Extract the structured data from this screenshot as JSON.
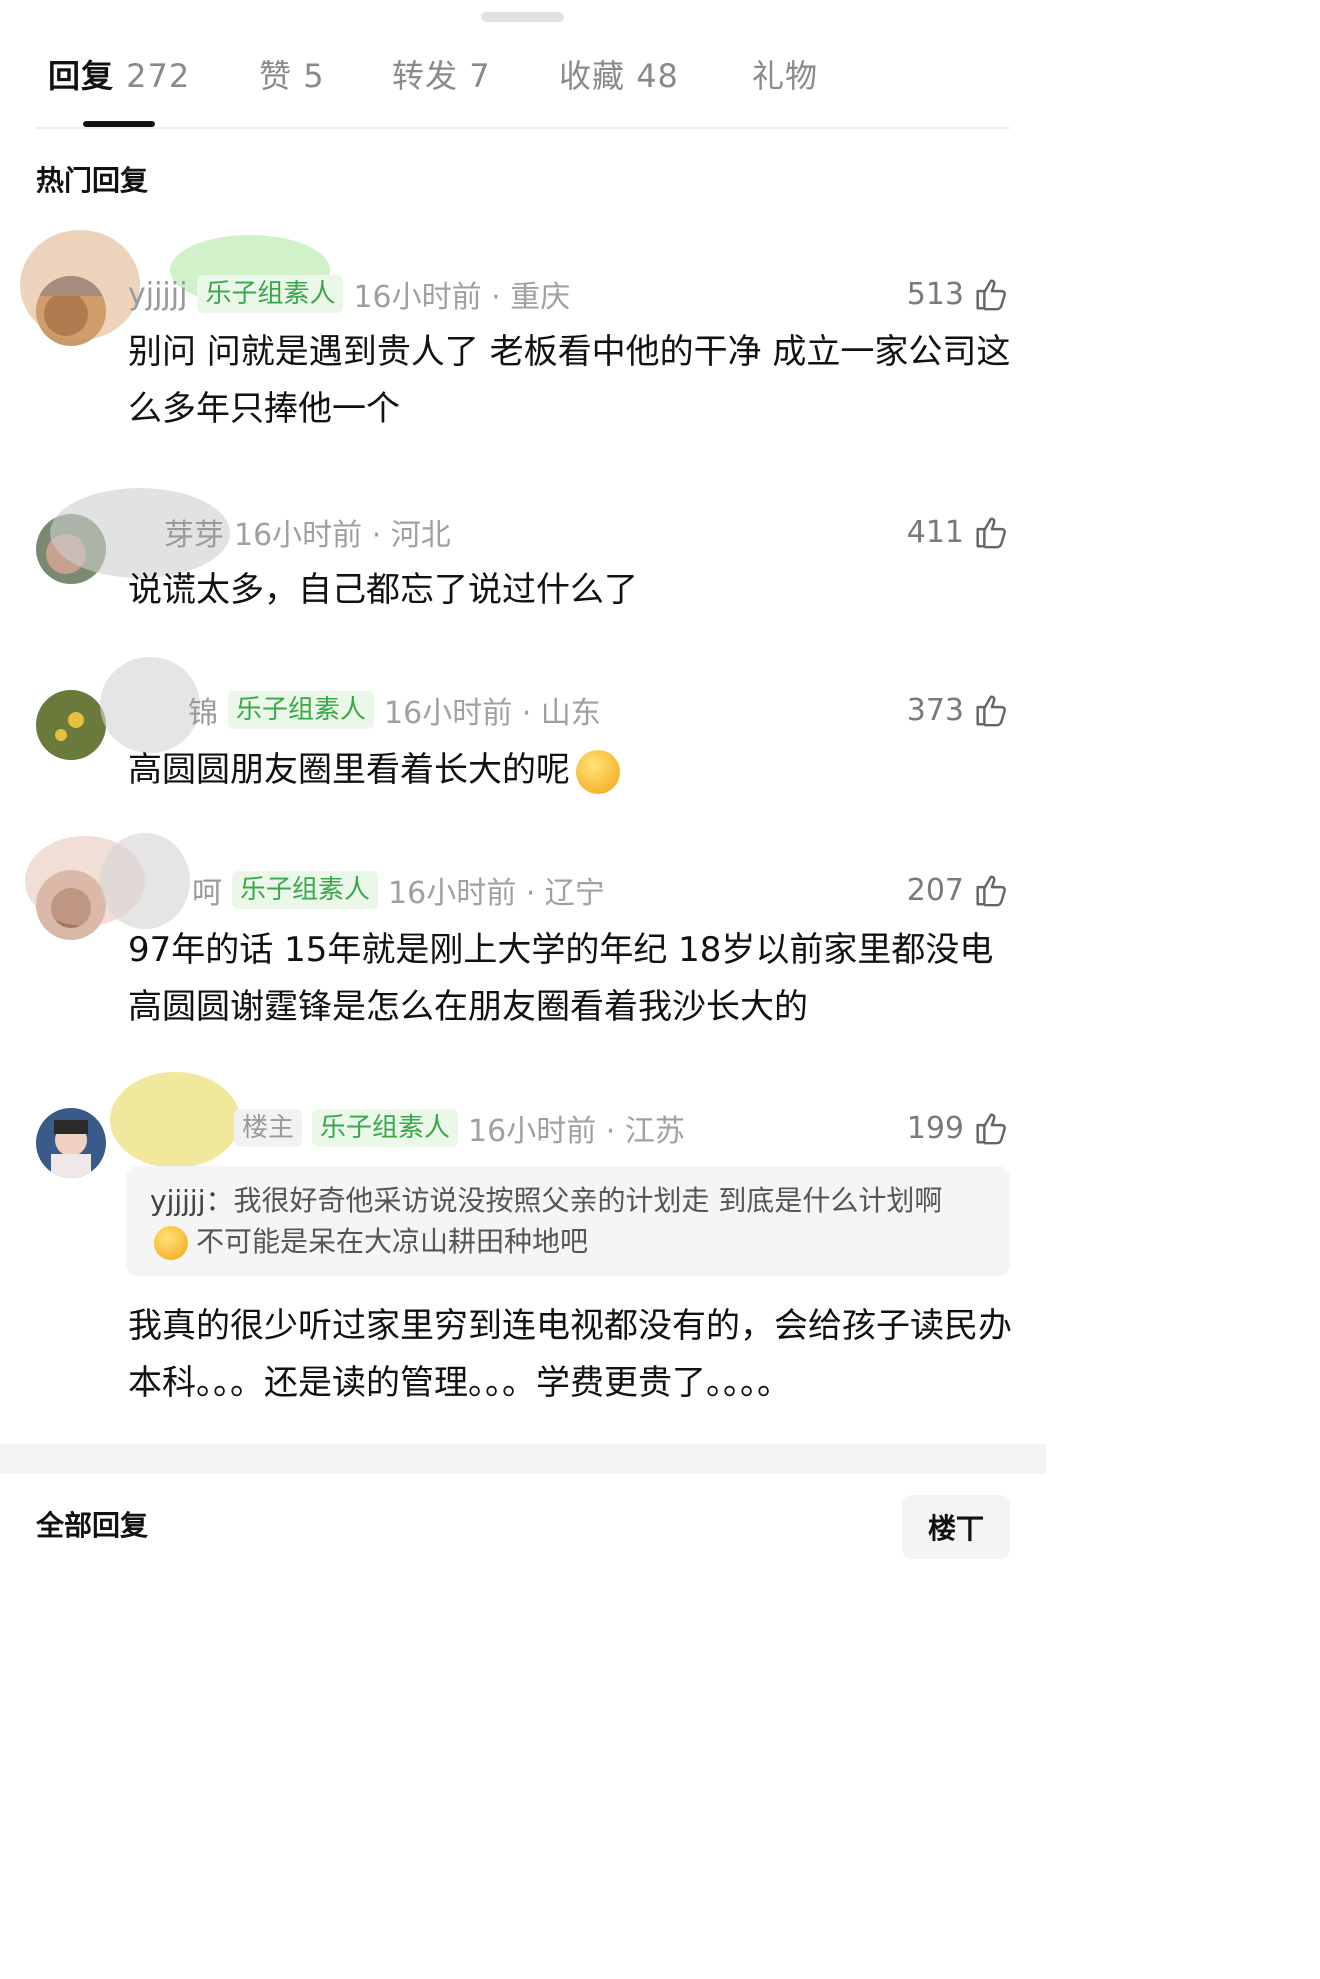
{
  "tabs": [
    {
      "label": "回复",
      "count": "272"
    },
    {
      "label": "赞",
      "count": "5"
    },
    {
      "label": "转发",
      "count": "7"
    },
    {
      "label": "收藏",
      "count": "48"
    },
    {
      "label": "礼物",
      "count": ""
    }
  ],
  "hot_title": "热门回复",
  "all_title": "全部回复",
  "sort_label": "楼丅",
  "colors": {
    "badge_green": "#3aa84a",
    "badge_bg": "#eaf7e9"
  },
  "comments": [
    {
      "username": "yjjjjj",
      "badge": "乐子组素人",
      "time_loc": "16小时前 · 重庆",
      "likes": "513",
      "text": "别问 问就是遇到贵人了 老板看中他的干净  成立一家公司这么多年只捧他一个"
    },
    {
      "username": "芽芽",
      "badge": "",
      "time_loc": "16小时前 · 河北",
      "likes": "411",
      "text": "说谎太多，自己都忘了说过什么了"
    },
    {
      "username": "锦",
      "badge": "乐子组素人",
      "time_loc": "16小时前 · 山东",
      "likes": "373",
      "text": "高圆圆朋友圈里看着长大的呢"
    },
    {
      "username": "呵",
      "badge": "乐子组素人",
      "time_loc": "16小时前 · 辽宁",
      "likes": "207",
      "text": "97年的话 15年就是刚上大学的年纪 18岁以前家里都没电 高圆圆谢霆锋是怎么在朋友圈看着我沙长大的"
    },
    {
      "username": "",
      "op_label": "楼主",
      "badge": "乐子组素人",
      "time_loc": "16小时前 · 江苏",
      "likes": "199",
      "quote_name": "yjjjjj：",
      "quote_text_1": "我很好奇他采访说没按照父亲的计划走  到底是什么计划啊",
      "quote_text_2": "不可能是呆在大凉山耕田种地吧",
      "text": "我真的很少听过家里穷到连电视都没有的，会给孩子读民办本科。。。还是读的管理。。。学费更贵了。。。。"
    }
  ]
}
